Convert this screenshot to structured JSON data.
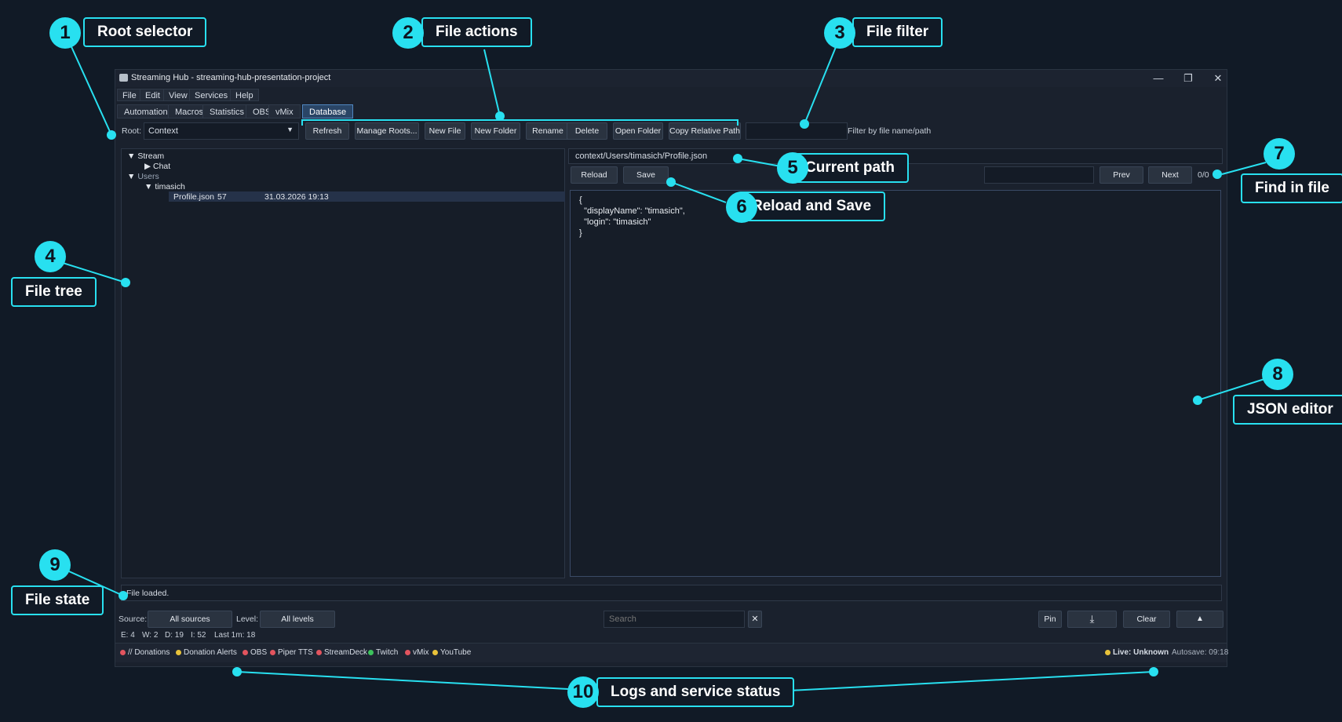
{
  "window": {
    "title": "Streaming Hub - streaming-hub-presentation-project",
    "controls": {
      "minimize": "—",
      "restore": "❐",
      "close": "✕"
    }
  },
  "menu": [
    "File",
    "Edit",
    "View",
    "Services",
    "Help"
  ],
  "tabs": [
    "Automation",
    "Macros",
    "Statistics",
    "OBS",
    "vMix",
    "Database"
  ],
  "toolbar": {
    "root_label": "Root:",
    "root_value": "Context",
    "buttons": [
      "Refresh",
      "Manage Roots...",
      "New File",
      "New Folder",
      "Rename",
      "Delete",
      "Open Folder",
      "Copy Relative Path"
    ],
    "filter_value": "",
    "filter_hint": "Filter by file name/path"
  },
  "tree": {
    "items": [
      {
        "label": "Stream",
        "arrow": "▼"
      },
      {
        "label": "Chat",
        "arrow": "▶"
      },
      {
        "label": "Users",
        "arrow": "▼"
      },
      {
        "label": "timasich",
        "arrow": "▼"
      },
      {
        "label": "Profile.json",
        "size": "57",
        "modified": "31.03.2026 19:13"
      }
    ]
  },
  "editor": {
    "current_path": "context/Users/timasich/Profile.json",
    "reload_label": "Reload",
    "save_label": "Save",
    "find_value": "",
    "prev_label": "Prev",
    "next_label": "Next",
    "match_count": "0/0",
    "content": "{\n  \"displayName\": \"timasich\",\n  \"login\": \"timasich\"\n}"
  },
  "file_state": "File loaded.",
  "logs": {
    "source_label": "Source:",
    "source_value": "All sources",
    "level_label": "Level:",
    "level_value": "All levels",
    "search_placeholder": "Search",
    "clear_search": "✕",
    "pin_label": "Pin",
    "download_icon": "⤓",
    "clear_label": "Clear",
    "collapse_icon": "▲",
    "counts": [
      "E: 4",
      "W: 2",
      "D: 19",
      "I: 52",
      "Last 1m: 18"
    ]
  },
  "services": [
    {
      "name": "// Donations",
      "color": "#e2545e"
    },
    {
      "name": "Donation Alerts",
      "color": "#e8c23a"
    },
    {
      "name": "OBS",
      "color": "#e2545e"
    },
    {
      "name": "Piper TTS",
      "color": "#e2545e"
    },
    {
      "name": "StreamDeck",
      "color": "#e2545e"
    },
    {
      "name": "Twitch",
      "color": "#3cc25c"
    },
    {
      "name": "vMix",
      "color": "#e2545e"
    },
    {
      "name": "YouTube",
      "color": "#e8c23a"
    }
  ],
  "live_status": {
    "label": "Live: Unknown",
    "color": "#e8c23a"
  },
  "autosave": "Autosave: 09:18",
  "callouts": [
    {
      "num": "1",
      "label": "Root selector"
    },
    {
      "num": "2",
      "label": "File actions"
    },
    {
      "num": "3",
      "label": "File filter"
    },
    {
      "num": "4",
      "label": "File tree"
    },
    {
      "num": "5",
      "label": "Current path"
    },
    {
      "num": "6",
      "label": "Reload and Save"
    },
    {
      "num": "7",
      "label": "Find in file"
    },
    {
      "num": "8",
      "label": "JSON editor"
    },
    {
      "num": "9",
      "label": "File state"
    },
    {
      "num": "10",
      "label": "Logs and service status"
    }
  ],
  "accent_color": "#28e0f0"
}
